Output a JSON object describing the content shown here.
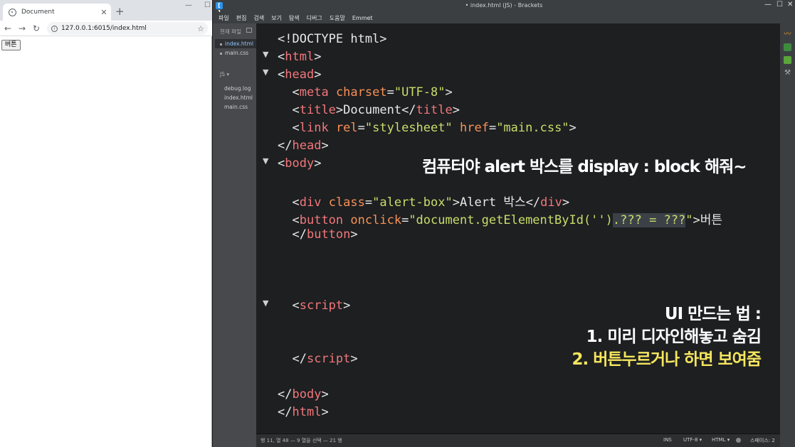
{
  "browser": {
    "tab_title": "Document",
    "tab_close": "✕",
    "new_tab": "+",
    "window_minimize": "—",
    "window_maximize": "☐",
    "url": "127.0.0.1:6015/index.html",
    "page_button_label": "버튼"
  },
  "brackets": {
    "window_title": "• index.html (JS) - Brackets",
    "window_controls": {
      "minimize": "—",
      "maximize": "☐",
      "close": "✕"
    },
    "menu": [
      "파일",
      "편집",
      "검색",
      "보기",
      "탐색",
      "디버그",
      "도움말",
      "Emmet"
    ],
    "sidebar": {
      "working_files_header": "현재 파일",
      "working_files": [
        "index.html",
        "main.css"
      ],
      "project_header": "JS ▾",
      "project_files": [
        "debug.log",
        "index.html",
        "main.css"
      ]
    },
    "code": {
      "doctype": "<!DOCTYPE html>",
      "html_open": "html",
      "head_open": "head",
      "meta_tag": "meta",
      "meta_attr": "charset",
      "meta_val": "\"UTF-8\"",
      "title_tag": "title",
      "title_text": "Document",
      "link_tag": "link",
      "link_rel_attr": "rel",
      "link_rel_val": "\"stylesheet\"",
      "link_href_attr": "href",
      "link_href_val": "\"main.css\"",
      "head_close": "head",
      "body_open": "body",
      "div_tag": "div",
      "div_attr": "class",
      "div_val": "\"alert-box\"",
      "div_text": "Alert 박스",
      "button_tag": "button",
      "button_attr": "onclick",
      "button_val_a": "\"document.getElementById('')",
      "button_val_sel": ".??? = ???",
      "button_val_b": "\"",
      "button_text": "버튼",
      "button_close": "button",
      "script_open": "script",
      "script_close": "script",
      "body_close": "body",
      "html_close": "html"
    },
    "overlay": {
      "caption": "컴퓨터야 alert 박스를 display : block 해줘~",
      "heading": "UI 만드는 법 :",
      "step1": "1. 미리 디자인해놓고 숨김",
      "step2": "2. 버튼누르거나 하면 보여줌"
    },
    "statusbar": {
      "cursor": "행 11, 열 48 — 9 열을 선택 — 21 행",
      "ins": "INS",
      "encoding": "UTF-8 ▾",
      "language": "HTML ▾",
      "spaces": "스페이스: 2"
    }
  }
}
